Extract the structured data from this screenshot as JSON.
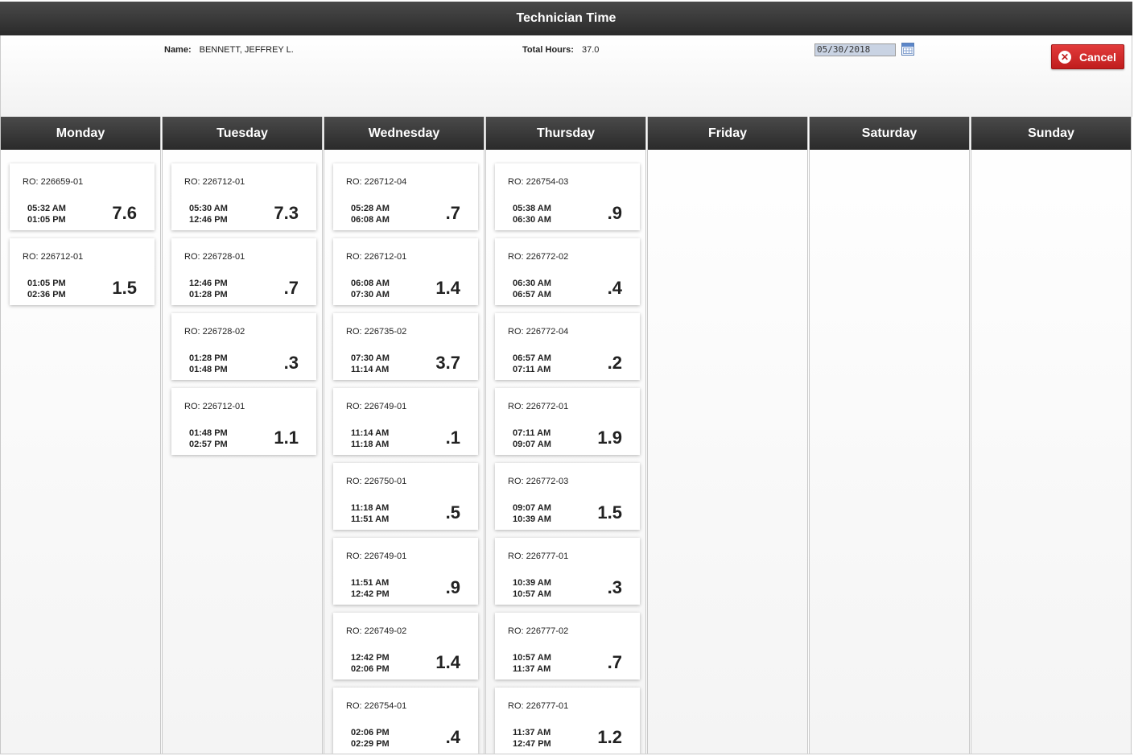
{
  "window": {
    "title": "Technician Time"
  },
  "header": {
    "name_label": "Name:",
    "name_value": "BENNETT, JEFFREY L.",
    "total_label": "Total Hours:",
    "total_value": "37.0",
    "date_value": "05/30/2018",
    "cancel_label": "Cancel"
  },
  "days": [
    {
      "name": "Monday",
      "entries": [
        {
          "ro": "RO: 226659-01",
          "start": "05:32 AM",
          "end": "01:05 PM",
          "hours": "7.6"
        },
        {
          "ro": "RO: 226712-01",
          "start": "01:05 PM",
          "end": "02:36 PM",
          "hours": "1.5"
        }
      ]
    },
    {
      "name": "Tuesday",
      "entries": [
        {
          "ro": "RO: 226712-01",
          "start": "05:30 AM",
          "end": "12:46 PM",
          "hours": "7.3"
        },
        {
          "ro": "RO: 226728-01",
          "start": "12:46 PM",
          "end": "01:28 PM",
          "hours": ".7"
        },
        {
          "ro": "RO: 226728-02",
          "start": "01:28 PM",
          "end": "01:48 PM",
          "hours": ".3"
        },
        {
          "ro": "RO: 226712-01",
          "start": "01:48 PM",
          "end": "02:57 PM",
          "hours": "1.1"
        }
      ]
    },
    {
      "name": "Wednesday",
      "entries": [
        {
          "ro": "RO: 226712-04",
          "start": "05:28 AM",
          "end": "06:08 AM",
          "hours": ".7"
        },
        {
          "ro": "RO: 226712-01",
          "start": "06:08 AM",
          "end": "07:30 AM",
          "hours": "1.4"
        },
        {
          "ro": "RO: 226735-02",
          "start": "07:30 AM",
          "end": "11:14 AM",
          "hours": "3.7"
        },
        {
          "ro": "RO: 226749-01",
          "start": "11:14 AM",
          "end": "11:18 AM",
          "hours": ".1"
        },
        {
          "ro": "RO: 226750-01",
          "start": "11:18 AM",
          "end": "11:51 AM",
          "hours": ".5"
        },
        {
          "ro": "RO: 226749-01",
          "start": "11:51 AM",
          "end": "12:42 PM",
          "hours": ".9"
        },
        {
          "ro": "RO: 226749-02",
          "start": "12:42 PM",
          "end": "02:06 PM",
          "hours": "1.4"
        },
        {
          "ro": "RO: 226754-01",
          "start": "02:06 PM",
          "end": "02:29 PM",
          "hours": ".4"
        }
      ]
    },
    {
      "name": "Thursday",
      "entries": [
        {
          "ro": "RO: 226754-03",
          "start": "05:38 AM",
          "end": "06:30 AM",
          "hours": ".9"
        },
        {
          "ro": "RO: 226772-02",
          "start": "06:30 AM",
          "end": "06:57 AM",
          "hours": ".4"
        },
        {
          "ro": "RO: 226772-04",
          "start": "06:57 AM",
          "end": "07:11 AM",
          "hours": ".2"
        },
        {
          "ro": "RO: 226772-01",
          "start": "07:11 AM",
          "end": "09:07 AM",
          "hours": "1.9"
        },
        {
          "ro": "RO: 226772-03",
          "start": "09:07 AM",
          "end": "10:39 AM",
          "hours": "1.5"
        },
        {
          "ro": "RO: 226777-01",
          "start": "10:39 AM",
          "end": "10:57 AM",
          "hours": ".3"
        },
        {
          "ro": "RO: 226777-02",
          "start": "10:57 AM",
          "end": "11:37 AM",
          "hours": ".7"
        },
        {
          "ro": "RO: 226777-01",
          "start": "11:37 AM",
          "end": "12:47 PM",
          "hours": "1.2"
        }
      ]
    },
    {
      "name": "Friday",
      "entries": []
    },
    {
      "name": "Saturday",
      "entries": []
    },
    {
      "name": "Sunday",
      "entries": []
    }
  ],
  "icons": {
    "calendar": "calendar-icon",
    "cancel": "close-circle-icon"
  },
  "colors": {
    "header_bar": "#2f2f2f",
    "cancel_button": "#d32a2a"
  }
}
